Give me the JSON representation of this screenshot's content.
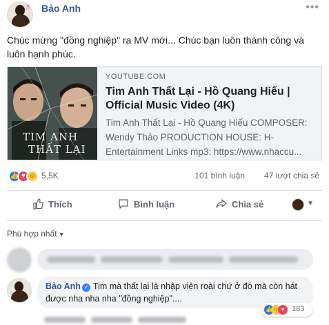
{
  "post": {
    "author": "Bảo Anh",
    "more_icon": "ellipsis-icon",
    "text": "Chúc mừng \"đồng nghiệp\" ra MV mới... Chúc bạn luôn thành công và luôn hạnh phúc."
  },
  "link_preview": {
    "domain": "YOUTUBE.COM",
    "title": "Tim Anh Thất Lại - Hồ Quang Hiếu | Official Music Video (4K)",
    "description": "Tim Anh Thất Lại - Hồ Quang Hiếu COMPOSER: Wendy Thảo PRODUCTION HOUSE: H-Entertainment Links mp3: https://www.nhaccu...",
    "thumbnail_text_line1": "TIM ANH",
    "thumbnail_text_line2": "THẤT LẠI"
  },
  "reactions": {
    "icons": [
      "like-icon",
      "love-icon",
      "haha-icon"
    ],
    "count": "5,5K",
    "comments": "101 bình luận",
    "shares": "47 lượt chia sẻ"
  },
  "actions": {
    "like_label": "Thích",
    "comment_label": "Bình luận",
    "share_label": "Chia sẻ"
  },
  "comments": {
    "sort_label": "Phù hợp nhất",
    "top_comment": {
      "author": "Bảo Anh",
      "text": "Tim mà thất lại là nhập viện roài chứ ở đó mà còn hát được nha nha nha \"đồng nghiệp\"....",
      "reaction_count": "183"
    }
  },
  "colors": {
    "link_blue": "#385898",
    "like_blue": "#2078f4",
    "love_red": "#f33e58",
    "haha_yellow": "#fccb42"
  }
}
